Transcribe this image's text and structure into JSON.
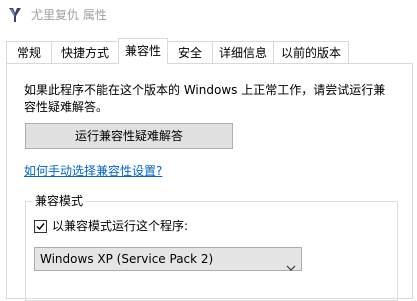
{
  "window": {
    "title": "尤里复仇 属性",
    "icon": "app-icon"
  },
  "tabs": [
    {
      "label": "常规",
      "active": false
    },
    {
      "label": "快捷方式",
      "active": false
    },
    {
      "label": "兼容性",
      "active": true
    },
    {
      "label": "安全",
      "active": false
    },
    {
      "label": "详细信息",
      "active": false
    },
    {
      "label": "以前的版本",
      "active": false
    }
  ],
  "compat": {
    "description": "如果此程序不能在这个版本的 Windows 上正常工作，请尝试运行兼容性疑难解答。",
    "troubleshoot_label": "运行兼容性疑难解答",
    "manual_link": "如何手动选择兼容性设置?",
    "mode_group_title": "兼容模式",
    "mode_checkbox_label": "以兼容模式运行这个程序:",
    "mode_checked": true,
    "mode_selected": "Windows XP (Service Pack 2)"
  },
  "colors": {
    "link": "#0066cc",
    "title_text": "#a0a0a0",
    "button_bg": "#e1e1e1"
  }
}
